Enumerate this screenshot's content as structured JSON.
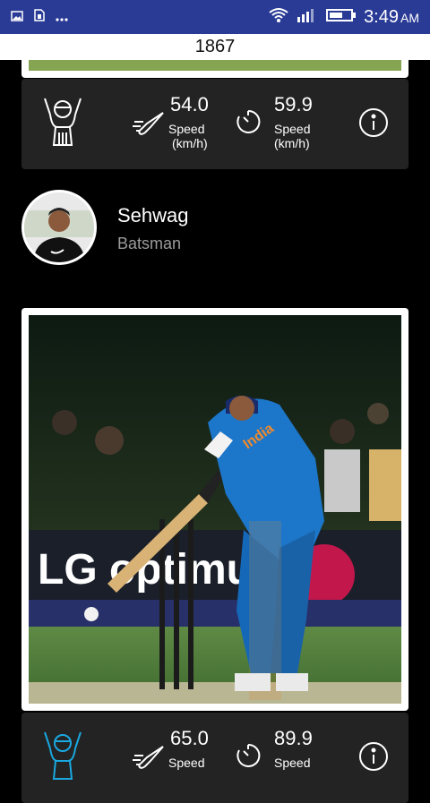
{
  "status": {
    "time": "3:49",
    "ampm": "AM"
  },
  "title": "1867",
  "cards": [
    {
      "speed1_value": "54.0",
      "speed1_label": "Speed",
      "speed1_unit": "(km/h)",
      "speed2_value": "59.9",
      "speed2_label": "Speed",
      "speed2_unit": "(km/h)"
    },
    {
      "speed1_value": "65.0",
      "speed1_label": "Speed",
      "speed2_value": "89.9",
      "speed2_label": "Speed"
    }
  ],
  "player": {
    "name": "Sehwag",
    "role": "Batsman"
  },
  "photo_banner": "LG optimu",
  "jersey_text": "India",
  "colors": {
    "status_bar": "#2a3b96",
    "card": "#232323",
    "role_text": "#9b9b9b",
    "accent": "#1aa8e0"
  },
  "icons": [
    "image-icon",
    "sim-icon",
    "more-icon",
    "wifi-icon",
    "signal-icon",
    "battery-icon",
    "batsman-icon",
    "bat-ball-icon",
    "timer-icon",
    "info-icon"
  ]
}
